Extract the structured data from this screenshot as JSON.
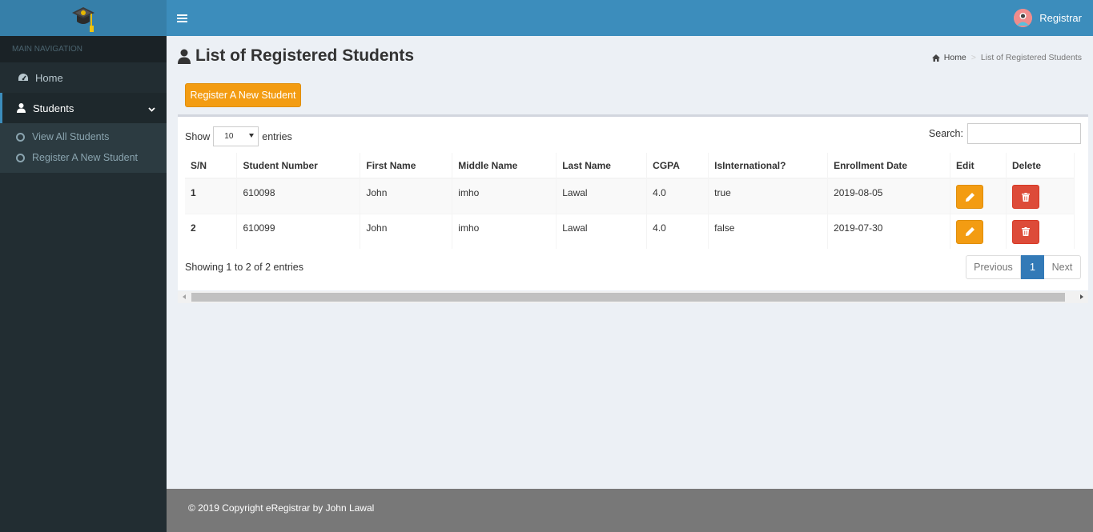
{
  "colors": {
    "header": "#3c8dbc",
    "sidebar": "#222d32",
    "warning": "#f39c12",
    "danger": "#dd4b39",
    "primary": "#337ab7"
  },
  "sidebar": {
    "logo_icon": "graduation-cap-icon",
    "header": "MAIN NAVIGATION",
    "items": [
      {
        "label": "Home",
        "icon": "dashboard-icon"
      },
      {
        "label": "Students",
        "icon": "user-icon",
        "active": true
      }
    ],
    "subitems": [
      {
        "label": "View All Students"
      },
      {
        "label": "Register A New Student"
      }
    ]
  },
  "topbar": {
    "user_name": "Registrar"
  },
  "page": {
    "title": "List of Registered Students",
    "breadcrumb": {
      "home": "Home",
      "current": "List of Registered Students"
    },
    "register_button": "Register A New Student"
  },
  "table_controls": {
    "show_label": "Show",
    "entries_value": "10",
    "entries_label": "entries",
    "search_label": "Search:",
    "search_value": "",
    "info": "Showing 1 to 2 of 2 entries",
    "prev": "Previous",
    "page": "1",
    "next": "Next"
  },
  "table": {
    "headers": [
      "S/N",
      "Student Number",
      "First Name",
      "Middle Name",
      "Last Name",
      "CGPA",
      "IsInternational?",
      "Enrollment Date",
      "Edit",
      "Delete"
    ],
    "rows": [
      {
        "sn": "1",
        "student_number": "610098",
        "first": "John",
        "middle": "imho",
        "last": "Lawal",
        "cgpa": "4.0",
        "intl": "true",
        "date": "2019-08-05"
      },
      {
        "sn": "2",
        "student_number": "610099",
        "first": "John",
        "middle": "imho",
        "last": "Lawal",
        "cgpa": "4.0",
        "intl": "false",
        "date": "2019-07-30"
      }
    ]
  },
  "footer": {
    "text": "© 2019 Copyright eRegistrar by John Lawal"
  }
}
